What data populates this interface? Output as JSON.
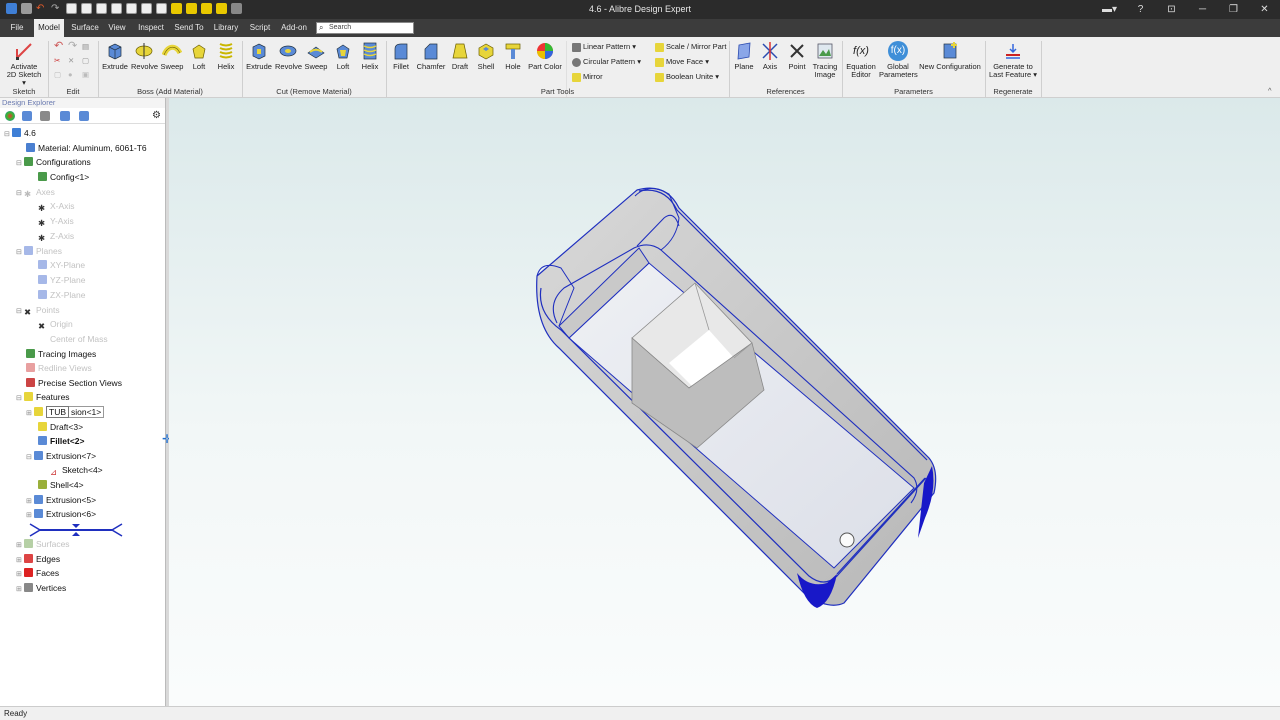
{
  "window": {
    "title": "4.6 - Alibre Design Expert"
  },
  "menu": {
    "tabs": [
      "File",
      "Model",
      "Surface",
      "View",
      "Inspect",
      "Send To",
      "Library",
      "Script",
      "Add-on"
    ],
    "active": "Model",
    "search_placeholder": "Search"
  },
  "ribbon": {
    "sketch": {
      "activate": "Activate",
      "activate2": "2D Sketch ▾",
      "group": "Sketch"
    },
    "edit": {
      "group": "Edit"
    },
    "boss": {
      "items": [
        "Extrude",
        "Revolve",
        "Sweep",
        "Loft",
        "Helix"
      ],
      "group": "Boss (Add Material)"
    },
    "cut": {
      "items": [
        "Extrude",
        "Revolve",
        "Sweep",
        "Loft",
        "Helix"
      ],
      "group": "Cut (Remove Material)"
    },
    "parttools": {
      "items": [
        "Fillet",
        "Chamfer",
        "Draft",
        "Shell",
        "Hole",
        "Part Color"
      ],
      "linear_pattern": "Linear Pattern",
      "circular_pattern": "Circular Pattern",
      "mirror": "Mirror",
      "scale_mirror": "Scale / Mirror Part",
      "move_face": "Move Face",
      "boolean_unite": "Boolean Unite",
      "group": "Part Tools"
    },
    "references": {
      "plane": "Plane",
      "axis": "Axis",
      "point": "Point",
      "tracing": "Tracing",
      "tracing2": "Image",
      "group": "References"
    },
    "parameters": {
      "equation": "Equation",
      "equation2": "Editor",
      "global": "Global",
      "global2": "Parameters",
      "newconfig": "New Configuration",
      "group": "Parameters"
    },
    "regenerate": {
      "gen": "Generate to",
      "gen2": "Last Feature ▾",
      "group": "Regenerate"
    }
  },
  "explorer": {
    "title": "Design Explorer",
    "root": "4.6",
    "material": "Material: Aluminum, 6061-T6",
    "configurations": "Configurations",
    "config1": "Config<1>",
    "axes": "Axes",
    "xaxis": "X-Axis",
    "yaxis": "Y-Axis",
    "zaxis": "Z-Axis",
    "planes": "Planes",
    "xyplane": "XY-Plane",
    "yzplane": "YZ-Plane",
    "zxplane": "ZX-Plane",
    "points": "Points",
    "origin": "Origin",
    "com": "Center of Mass",
    "tracing_images": "Tracing Images",
    "redline": "Redline Views",
    "section": "Precise Section Views",
    "features": "Features",
    "rename_value": "TUB",
    "rename_tail": "sion<1>",
    "draft3": "Draft<3>",
    "fillet2": "Fillet<2>",
    "extrusion7": "Extrusion<7>",
    "sketch4": "Sketch<4>",
    "shell4": "Shell<4>",
    "extrusion5": "Extrusion<5>",
    "extrusion6": "Extrusion<6>",
    "surfaces": "Surfaces",
    "edges": "Edges",
    "faces": "Faces",
    "vertices": "Vertices"
  },
  "status": {
    "text": "Ready"
  },
  "colors": {
    "accent_blue": "#1f2fbf",
    "titlebar": "#2b2b2b",
    "menubar": "#3c3c3c"
  }
}
